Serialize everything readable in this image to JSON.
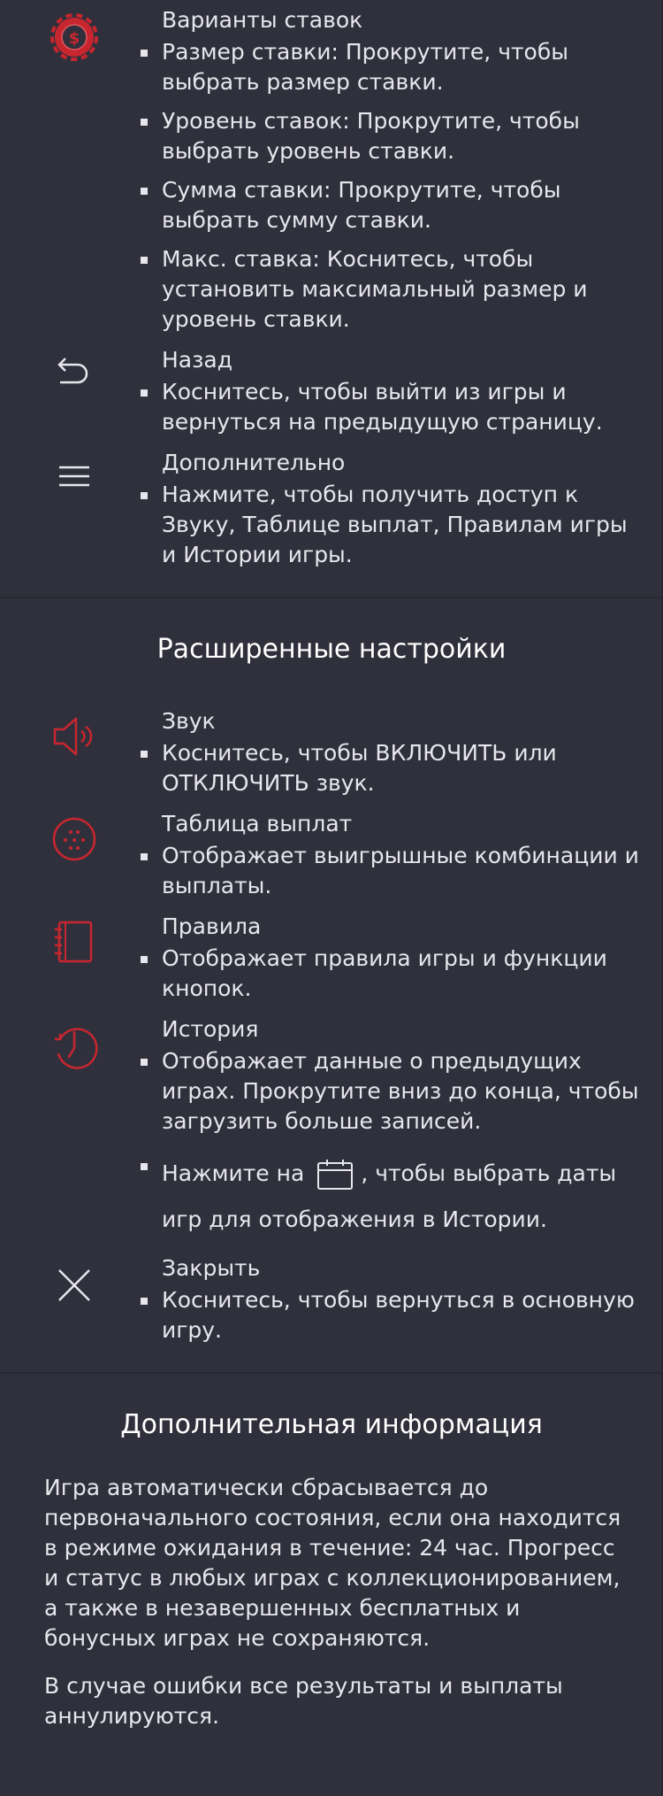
{
  "colors": {
    "background": "#30303c",
    "text": "#e6e6ec",
    "accent_red": "#c8262e",
    "divider": "#282832"
  },
  "controls": {
    "bet_options": {
      "icon": "bet-chip-icon",
      "title": "Варианты ставок",
      "bullets": [
        "Размер ставки: Прокрутите, чтобы выбрать размер ставки.",
        "Уровень ставок: Прокрутите, чтобы выбрать уровень ставки.",
        "Сумма ставки: Прокрутите, чтобы выбрать сумму ставки.",
        "Макс. ставка: Коснитесь, чтобы установить максимальный размер и уровень ставки."
      ]
    },
    "back": {
      "icon": "back-arrow-icon",
      "title": "Назад",
      "bullets": [
        "Коснитесь, чтобы выйти из игры и вернуться на предыдущую страницу."
      ]
    },
    "more": {
      "icon": "menu-icon",
      "title": "Дополнительно",
      "bullets": [
        "Нажмите, чтобы получить доступ к Звуку, Таблице выплат, Правилам игры и Истории игры."
      ]
    }
  },
  "advanced": {
    "title": "Расширенные настройки",
    "sound": {
      "icon": "speaker-icon",
      "title": "Звук",
      "bullets": [
        "Коснитесь, чтобы ВКЛЮЧИТЬ или ОТКЛЮЧИТЬ звук."
      ]
    },
    "paytable": {
      "icon": "paytable-icon",
      "title": "Таблица выплат",
      "bullets": [
        "Отображает выигрышные комбинации и выплаты."
      ]
    },
    "rules": {
      "icon": "notebook-icon",
      "title": "Правила",
      "bullets": [
        "Отображает правила игры и функции кнопок."
      ]
    },
    "history": {
      "icon": "history-clock-icon",
      "title": "История",
      "bullets": [
        "Отображает данные о предыдущих играх. Прокрутите вниз до конца, чтобы загрузить больше записей."
      ],
      "calendar_before": "Нажмите на",
      "calendar_after": ", чтобы выбрать даты игр для отображения в Истории.",
      "calendar_icon": "calendar-icon"
    },
    "close": {
      "icon": "close-icon",
      "title": "Закрыть",
      "bullets": [
        "Коснитесь, чтобы вернуться в основную игру."
      ]
    }
  },
  "additional": {
    "title": "Дополнительная информация",
    "paragraphs": [
      "Игра автоматически сбрасывается до первоначального состояния, если она находится в режиме ожидания в течение: 24 час. Прогресс и статус в любых играх с коллекционированием, а также в незавершенных бесплатных и бонусных играх не сохраняются.",
      "В случае ошибки все результаты и выплаты аннулируются."
    ]
  }
}
